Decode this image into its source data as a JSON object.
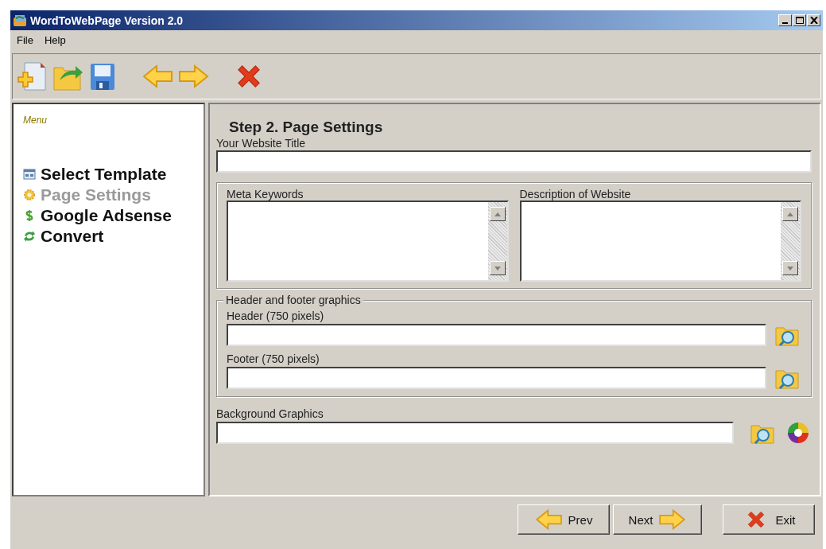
{
  "window": {
    "title": "WordToWebPage Version 2.0"
  },
  "menu": [
    "File",
    "Help"
  ],
  "sidebar": {
    "header": "Menu",
    "items": [
      {
        "label": "Select Template",
        "kind": "template",
        "selected": false
      },
      {
        "label": "Page Settings",
        "kind": "settings",
        "selected": true
      },
      {
        "label": "Google Adsense",
        "kind": "money",
        "selected": false
      },
      {
        "label": "Convert",
        "kind": "convert",
        "selected": false
      }
    ]
  },
  "content": {
    "step_title": "Step 2. Page Settings",
    "website_title_label": "Your Website Title",
    "meta_keywords_label": "Meta Keywords",
    "description_label": "Description of Website",
    "graphics_group": "Header and footer graphics",
    "header_label": "Header (750 pixels)",
    "footer_label": "Footer (750 pixels)",
    "background_label": "Background Graphics"
  },
  "buttons": [
    {
      "label": "Prev",
      "kind": "prev"
    },
    {
      "label": "Next",
      "kind": "next"
    },
    {
      "label": "Exit",
      "kind": "exit"
    }
  ]
}
